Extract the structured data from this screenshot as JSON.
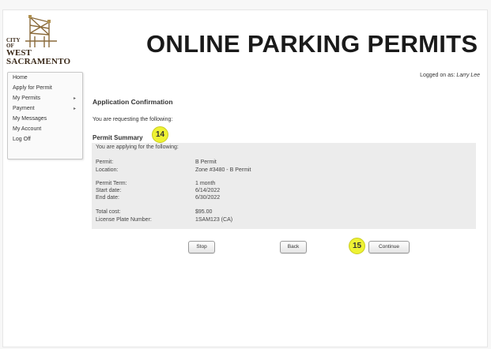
{
  "header": {
    "logo": {
      "line1": "CITY",
      "line2": "OF",
      "line3": "WEST",
      "line4": "SACRAMENTO"
    },
    "title": "ONLINE PARKING PERMITS",
    "logged_prefix": "Logged on as: ",
    "logged_user": "Larry Lee"
  },
  "sidebar": {
    "items": [
      {
        "label": "Home",
        "has_submenu": false
      },
      {
        "label": "Apply for Permit",
        "has_submenu": false
      },
      {
        "label": "My Permits",
        "has_submenu": true
      },
      {
        "label": "Payment",
        "has_submenu": true
      },
      {
        "label": "My Messages",
        "has_submenu": false
      },
      {
        "label": "My Account",
        "has_submenu": false
      },
      {
        "label": "Log Off",
        "has_submenu": false
      }
    ],
    "arrow": "▸"
  },
  "main": {
    "section_title": "Application Confirmation",
    "requesting_text": "You are requesting the following:",
    "summary_title": "Permit Summary",
    "applying_text": "You are applying for the following:",
    "rows": [
      {
        "label": "Permit:",
        "value": "B Permit"
      },
      {
        "label": "Location:",
        "value": "Zone #3480 - B Permit"
      },
      {
        "label": "Permit Term:",
        "value": "1 month"
      },
      {
        "label": "Start date:",
        "value": "6/14/2022"
      },
      {
        "label": "End date:",
        "value": "6/30/2022"
      },
      {
        "label": "Total cost:",
        "value": "$95.00"
      },
      {
        "label": "License Plate Number:",
        "value": "1SAM123 (CA)"
      }
    ]
  },
  "buttons": {
    "stop": "Stop",
    "back": "Back",
    "continue": "Continue"
  },
  "markers": {
    "m14": "14",
    "m15": "15"
  },
  "colors": {
    "marker": "#eef233",
    "summary_bg": "#ececec",
    "logo_brown": "#3b2a1a"
  },
  "icons": {
    "submenu": "chevron-right-icon",
    "logo": "bridge-logo-icon"
  }
}
